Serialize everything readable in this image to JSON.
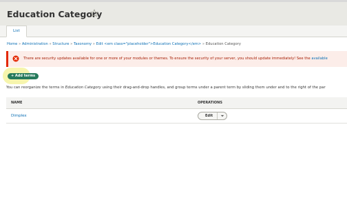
{
  "page": {
    "title": "Education Category",
    "tabs": [
      {
        "label": "List"
      }
    ]
  },
  "breadcrumb": {
    "items": [
      "Home",
      "Administration",
      "Structure",
      "Taxonomy",
      "Edit <em class=\"placeholder\">Education Category</em>"
    ],
    "current": "Education Category",
    "separator": "»"
  },
  "message": {
    "type": "error",
    "icon": "error-circle-icon",
    "text": "There are security updates available for one or more of your modules or themes. To ensure the security of your server, you should update immediately! See the",
    "link": "available"
  },
  "actions": {
    "add_terms_label": "+ Add terms"
  },
  "description": {
    "before": "You can reorganize the terms in ",
    "emphasis": "Education Category",
    "after": " using their drag-and-drop handles, and group terms under a parent term by sliding them under and to the right of the par"
  },
  "table": {
    "headers": [
      "NAME",
      "OPERATIONS"
    ],
    "rows": [
      {
        "name": "Dimplex",
        "operation": "Edit"
      }
    ]
  },
  "colors": {
    "header_bg": "#e9e9e4",
    "link": "#0a6eb4",
    "error": "#e32700",
    "button_green": "#267a5c",
    "highlight": "#f5f4a4"
  }
}
